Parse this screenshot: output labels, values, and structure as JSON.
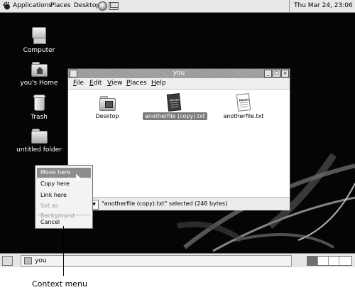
{
  "top_panel": {
    "menus": [
      "Applications",
      "Places",
      "Desktop"
    ],
    "clock": "Thu Mar 24, 23:06"
  },
  "desktop_icons": [
    {
      "label": "Computer",
      "icon": "computer-icon"
    },
    {
      "label": "you's Home",
      "icon": "home-folder-icon"
    },
    {
      "label": "Trash",
      "icon": "trash-icon"
    },
    {
      "label": "untitled folder",
      "icon": "folder-icon"
    }
  ],
  "window": {
    "title": "you",
    "menus": [
      {
        "label": "File",
        "mnemonic": "F",
        "rest": "ile"
      },
      {
        "label": "Edit",
        "mnemonic": "E",
        "rest": "dit"
      },
      {
        "label": "View",
        "mnemonic": "V",
        "rest": "iew"
      },
      {
        "label": "Places",
        "mnemonic": "P",
        "rest": "laces"
      },
      {
        "label": "Help",
        "mnemonic": "H",
        "rest": "elp"
      }
    ],
    "files": [
      {
        "label": "Desktop",
        "type": "folder"
      },
      {
        "label": "anotherfile (copy).txt",
        "type": "text",
        "selected": true
      },
      {
        "label": "anotherfile.txt",
        "type": "text"
      }
    ],
    "status": "\"anotherfile (copy).txt\" selected (246 bytes)"
  },
  "context_menu": {
    "items": [
      {
        "label": "Move here",
        "state": "highlighted"
      },
      {
        "label": "Copy here",
        "state": "normal"
      },
      {
        "label": "Link here",
        "state": "normal"
      },
      {
        "label": "Set as Background",
        "state": "disabled"
      },
      {
        "label": "Cancel",
        "state": "normal"
      }
    ]
  },
  "bottom_panel": {
    "task": "you"
  },
  "callout": "Context menu",
  "colors": {
    "desktop": "#050505",
    "panel": "#e9e9e9",
    "highlight": "#8d8d8d"
  }
}
